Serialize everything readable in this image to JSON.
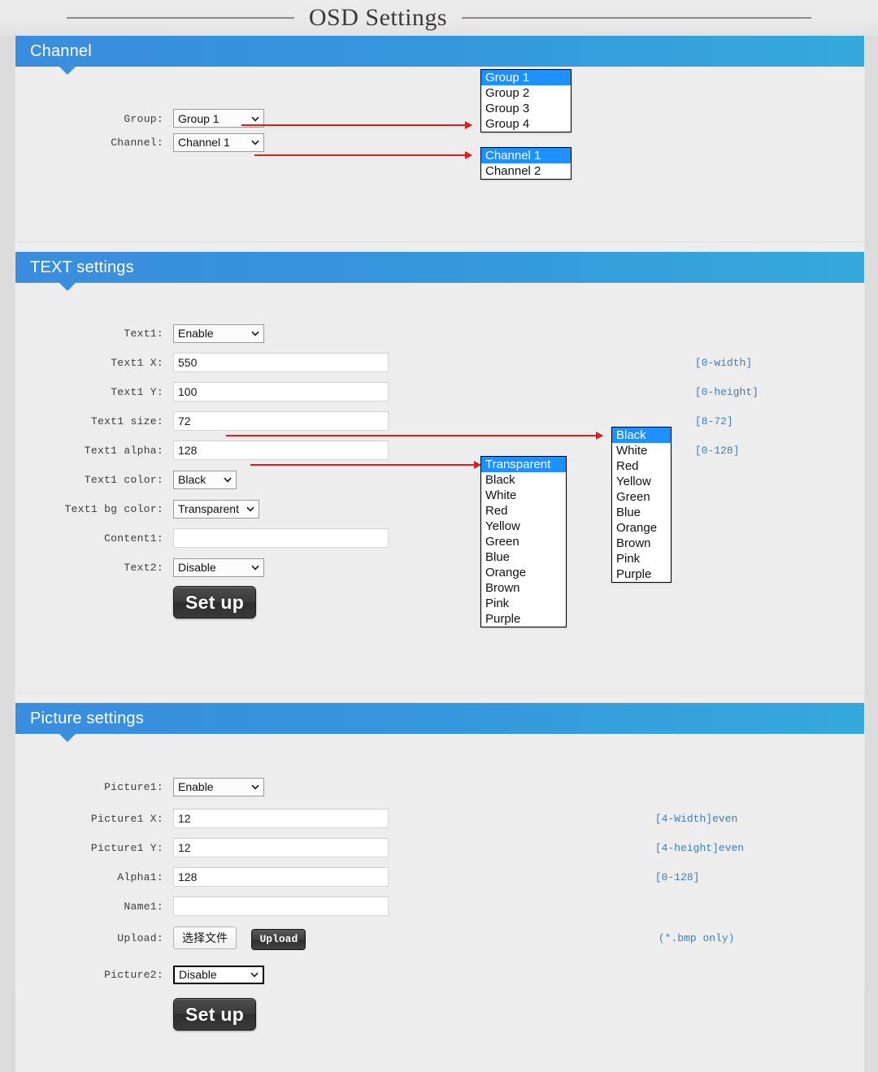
{
  "page": {
    "title": "OSD Settings"
  },
  "sections": {
    "channel": {
      "title": "Channel",
      "rows": {
        "group": {
          "label": "Group:",
          "value": "Group 1",
          "options": [
            "Group 1",
            "Group 2",
            "Group 3",
            "Group 4"
          ],
          "selected_index": 0
        },
        "channel": {
          "label": "Channel:",
          "value": "Channel 1",
          "options": [
            "Channel 1",
            "Channel 2"
          ],
          "selected_index": 0
        }
      }
    },
    "text": {
      "title": "TEXT settings",
      "rows": {
        "text1": {
          "label": "Text1:",
          "value": "Enable"
        },
        "text1_x": {
          "label": "Text1 X:",
          "value": "550",
          "hint": "[0-width]"
        },
        "text1_y": {
          "label": "Text1 Y:",
          "value": "100",
          "hint": "[0-height]"
        },
        "text1_size": {
          "label": "Text1 size:",
          "value": "72",
          "hint": "[8-72]"
        },
        "text1_alpha": {
          "label": "Text1 alpha:",
          "value": "128",
          "hint": "[0-128]"
        },
        "text1_color": {
          "label": "Text1 color:",
          "value": "Black",
          "options": [
            "Black",
            "White",
            "Red",
            "Yellow",
            "Green",
            "Blue",
            "Orange",
            "Brown",
            "Pink",
            "Purple"
          ],
          "selected_index": 0
        },
        "text1_bg_color": {
          "label": "Text1 bg color:",
          "value": "Transparent",
          "options": [
            "Transparent",
            "Black",
            "White",
            "Red",
            "Yellow",
            "Green",
            "Blue",
            "Orange",
            "Brown",
            "Pink",
            "Purple"
          ],
          "selected_index": 0
        },
        "content1": {
          "label": "Content1:",
          "value": "",
          "placeholder": ""
        },
        "text2": {
          "label": "Text2:",
          "value": "Disable"
        }
      },
      "setup_button": "Set up"
    },
    "picture": {
      "title": "Picture settings",
      "rows": {
        "picture1": {
          "label": "Picture1:",
          "value": "Enable"
        },
        "picture1_x": {
          "label": "Picture1 X:",
          "value": "12",
          "hint": "[4-Width]even"
        },
        "picture1_y": {
          "label": "Picture1 Y:",
          "value": "12",
          "hint": "[4-height]even"
        },
        "alpha1": {
          "label": "Alpha1:",
          "value": "128",
          "hint": "[0-128]"
        },
        "name1": {
          "label": "Name1:",
          "value": "",
          "placeholder": ""
        },
        "upload": {
          "label": "Upload:",
          "choose_file_button": "选择文件",
          "upload_button": "Upload",
          "hint": "(*.bmp only)"
        },
        "picture2": {
          "label": "Picture2:",
          "value": "Disable"
        }
      },
      "setup_button": "Set up"
    }
  },
  "colors": {
    "header_gradient_start": "#3a8dde",
    "header_gradient_end": "#35a9dc",
    "option_highlight": "#1e90ff",
    "hint_text": "#3d7eb5",
    "annotation_arrow": "#e01b1b",
    "page_background": "#dcdcdc",
    "panel_background": "#ededed"
  }
}
